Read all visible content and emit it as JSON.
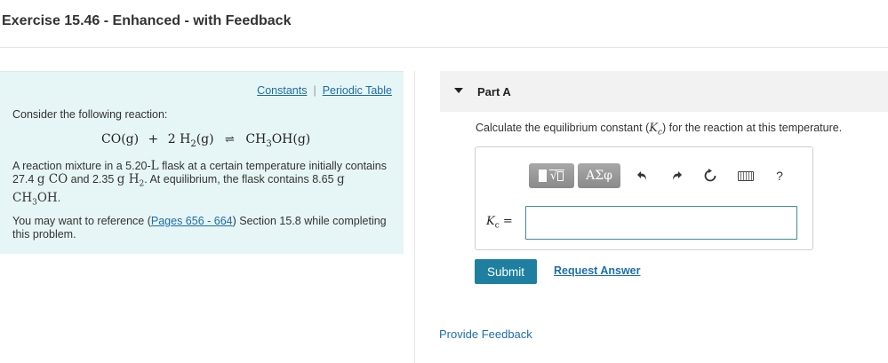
{
  "page": {
    "title": "Exercise 15.46 - Enhanced - with Feedback"
  },
  "info_panel": {
    "links": {
      "constants": "Constants",
      "separator": "|",
      "periodic_table": "Periodic Table"
    },
    "consider": "Consider the following reaction:",
    "equation": {
      "reactant1": "CO(g)",
      "plus": "+",
      "reactant2_coef": "2",
      "reactant2_sym": "H",
      "reactant2_sub": "2",
      "reactant2_state": "(g)",
      "arrow": "⇌",
      "product_a": "CH",
      "product_sub": "3",
      "product_b": "OH(g)"
    },
    "mixture": {
      "line1": "A reaction mixture in a 5.20-",
      "unit_L": "L",
      "line1b": " flask at a certain temperature initially contains 27.4 ",
      "g1": "g CO",
      "and": " and 2.35 ",
      "g2_a": "g H",
      "g2_sub": "2",
      "at_eq": ". At equilibrium, the flask contains 8.65 ",
      "g3_a": "g CH",
      "g3_sub": "3",
      "g3_b": "OH",
      "end": "."
    },
    "reference": {
      "prefix": "You may want to reference (",
      "link": "Pages 656 - 664",
      "suffix": ") Section 15.8 while completing this problem."
    }
  },
  "part": {
    "label": "Part A",
    "question_prefix": "Calculate the equilibrium constant (",
    "question_symbol": "K",
    "question_sub": "c",
    "question_suffix": ") for the reaction at this temperature."
  },
  "answer": {
    "toolbar": {
      "greek": "ΑΣφ",
      "undo_icon": "undo-icon",
      "redo_icon": "redo-icon",
      "reset_icon": "reset-icon",
      "keyboard_icon": "keyboard-icon",
      "help": "?"
    },
    "label_symbol": "K",
    "label_sub": "c",
    "label_eq": " =",
    "value": ""
  },
  "actions": {
    "submit": "Submit",
    "request_answer": "Request Answer",
    "provide_feedback": "Provide Feedback"
  }
}
